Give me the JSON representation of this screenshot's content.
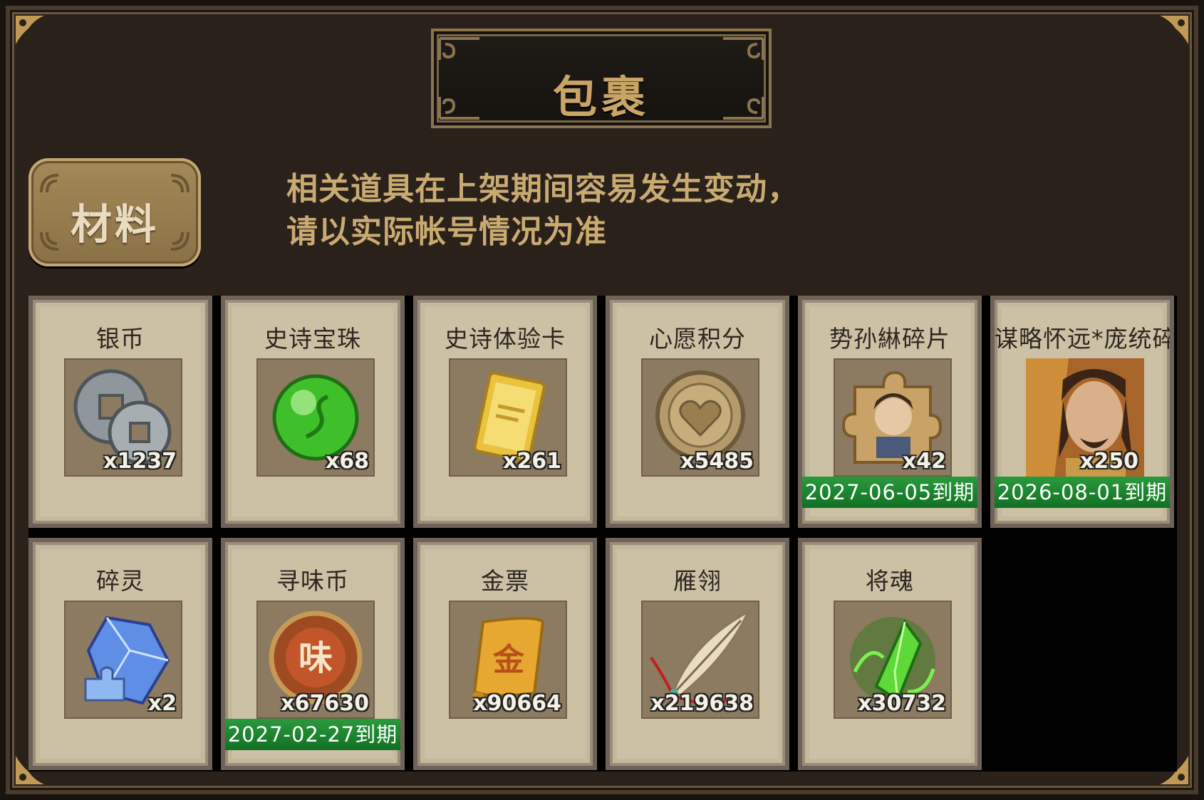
{
  "header": {
    "title": "包裹"
  },
  "tab": {
    "label": "材料"
  },
  "notice": {
    "line1": "相关道具在上架期间容易发生变动，",
    "line2": "请以实际帐号情况为准"
  },
  "items": [
    {
      "name": "银币",
      "qty": "x1237",
      "icon": "silver-coin-icon"
    },
    {
      "name": "史诗宝珠",
      "qty": "x68",
      "icon": "green-orb-icon"
    },
    {
      "name": "史诗体验卡",
      "qty": "x261",
      "icon": "gold-card-icon"
    },
    {
      "name": "心愿积分",
      "qty": "x5485",
      "icon": "heart-coin-icon"
    },
    {
      "name": "势孙綝碎片",
      "qty": "x42",
      "icon": "hero-fragment-icon",
      "expiry": "2027-06-05到期"
    },
    {
      "name": "谋略怀远*庞统碎片",
      "qty": "x250",
      "icon": "hero-portrait-icon",
      "expiry": "2026-08-01到期"
    },
    {
      "name": "碎灵",
      "qty": "x2",
      "icon": "blue-crystal-icon"
    },
    {
      "name": "寻味币",
      "qty": "x67630",
      "icon": "taste-coin-icon",
      "expiry": "2027-02-27到期"
    },
    {
      "name": "金票",
      "qty": "x90664",
      "icon": "gold-ticket-icon"
    },
    {
      "name": "雁翎",
      "qty": "x219638",
      "icon": "feather-icon"
    },
    {
      "name": "将魂",
      "qty": "x30732",
      "icon": "green-soul-crystal-icon"
    }
  ]
}
